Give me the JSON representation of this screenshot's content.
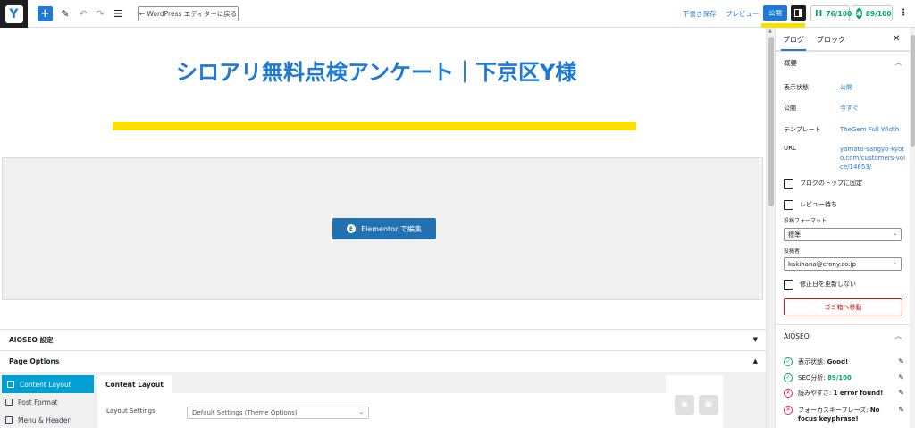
{
  "topbar": {
    "logo_letter": "Y",
    "add_icon": "plus-icon",
    "back_label": "← WordPress エディターに戻る",
    "draft_label": "下書き保存",
    "preview_label": "プレビュー",
    "publish_label": "公開",
    "score1": "76/100",
    "score2": "89/100",
    "kebab": "⋮"
  },
  "document": {
    "title": "シロアリ無料点検アンケート｜下京区Y様",
    "elementor_button": "Elementor で編集",
    "elementor_icon_letter": "E"
  },
  "metaboxes": {
    "aioseo_label": "AIOSEO 設定",
    "pageoptions_label": "Page Options"
  },
  "page_options": {
    "tabs": [
      {
        "label": "Content Layout",
        "icon": "layout-icon"
      },
      {
        "label": "Post Format",
        "icon": "format-icon"
      },
      {
        "label": "Menu & Header",
        "icon": "menu-icon"
      }
    ],
    "panel_tab": "Content Layout",
    "layout_settings_label": "Layout Settings",
    "layout_settings_value": "Default Settings (Theme Options)"
  },
  "sidebar": {
    "tab_post": "ブログ",
    "tab_block": "ブロック",
    "summary_title": "概要",
    "rows": [
      {
        "key": "表示状態",
        "value": "公開"
      },
      {
        "key": "公開",
        "value": "今すぐ"
      },
      {
        "key": "テンプレート",
        "value": "TheGem Full Width"
      },
      {
        "key": "URL",
        "value": "yamato-sangyo-kyoto.com/customers-voice/14653/"
      }
    ],
    "sticky_label": "ブログのトップに固定",
    "pending_label": "レビュー待ち",
    "format_label": "投稿フォーマット",
    "format_value": "標準",
    "author_label": "投稿者",
    "author_value": "kakihana@crony.co.jp",
    "nomodify_label": "修正日を更新しない",
    "trash_label": "ゴミ箱へ移動",
    "aioseo_title": "AIOSEO",
    "aioseo_rows": [
      {
        "label": "表示状態:",
        "value": "Good!",
        "status": "ok"
      },
      {
        "label": "SEO分析:",
        "value": "89/100",
        "status": "ok"
      },
      {
        "label": "読みやすさ:",
        "value": "1 error found!",
        "status": "err"
      },
      {
        "label": "フォーカスキーフレーズ:",
        "value": "No focus keyphrase!",
        "status": "err"
      }
    ]
  },
  "colors": {
    "accent": "#1e7ad4",
    "highlight": "#f9e000",
    "good": "#00aa63",
    "error": "#df2a4a"
  }
}
